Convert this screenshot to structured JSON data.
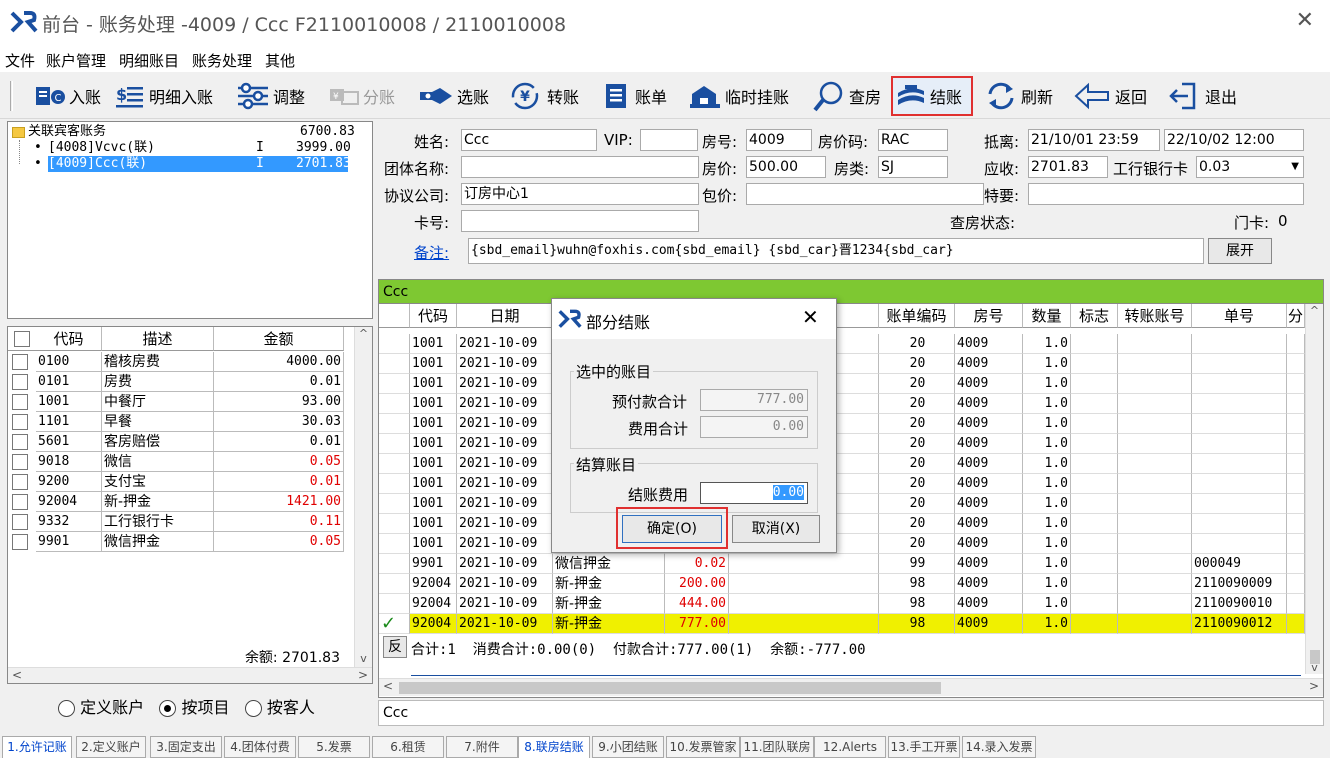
{
  "window": {
    "title": "前台 - 账务处理 -4009 / Ccc F2110010008 / 2110010008",
    "close": "✕"
  },
  "menu": [
    "文件",
    "账户管理",
    "明细账目",
    "账务处理",
    "其他"
  ],
  "toolbar": [
    {
      "label": "入账",
      "icon": "post-icon"
    },
    {
      "label": "明细入账",
      "icon": "detail-post-icon"
    },
    {
      "label": "调整",
      "icon": "adjust-icon"
    },
    {
      "label": "分账",
      "icon": "split-icon",
      "disabled": true
    },
    {
      "label": "选账",
      "icon": "select-icon"
    },
    {
      "label": "转账",
      "icon": "transfer-icon"
    },
    {
      "label": "账单",
      "icon": "bill-icon"
    },
    {
      "label": "临时挂账",
      "icon": "hold-icon"
    },
    {
      "label": "查房",
      "icon": "inspect-icon"
    },
    {
      "label": "结账",
      "icon": "checkout-icon",
      "selected": true
    },
    {
      "label": "刷新",
      "icon": "refresh-icon"
    },
    {
      "label": "返回",
      "icon": "back-icon"
    },
    {
      "label": "退出",
      "icon": "exit-icon"
    }
  ],
  "tree": {
    "root": {
      "label": "关联宾客账务",
      "amount": "6700.83"
    },
    "children": [
      {
        "label": "[4008]Vcvc(联)",
        "flag": "I",
        "amount": "3999.00",
        "selected": false
      },
      {
        "label": "[4009]Ccc(联)",
        "flag": "I",
        "amount": "2701.83",
        "selected": true
      }
    ]
  },
  "items_grid": {
    "headers": [
      "代码",
      "描述",
      "金额"
    ],
    "rows": [
      {
        "code": "0100",
        "desc": "稽核房费",
        "amount": "4000.00",
        "red": false
      },
      {
        "code": "0101",
        "desc": "房费",
        "amount": "0.01",
        "red": false
      },
      {
        "code": "1001",
        "desc": "中餐厅",
        "amount": "93.00",
        "red": false
      },
      {
        "code": "1101",
        "desc": "早餐",
        "amount": "30.03",
        "red": false
      },
      {
        "code": "5601",
        "desc": "客房赔偿",
        "amount": "0.01",
        "red": false
      },
      {
        "code": "9018",
        "desc": "微信",
        "amount": "0.05",
        "red": true
      },
      {
        "code": "9200",
        "desc": "支付宝",
        "amount": "0.01",
        "red": true
      },
      {
        "code": "92004",
        "desc": "新-押金",
        "amount": "1421.00",
        "red": true
      },
      {
        "code": "9332",
        "desc": "工行银行卡",
        "amount": "0.11",
        "red": true
      },
      {
        "code": "9901",
        "desc": "微信押金",
        "amount": "0.05",
        "red": true
      }
    ],
    "balance": "余额: 2701.83"
  },
  "radios": [
    {
      "label": "定义账户",
      "checked": false
    },
    {
      "label": "按项目",
      "checked": true
    },
    {
      "label": "按客人",
      "checked": false
    }
  ],
  "guest": {
    "name_label": "姓名:",
    "name": "Ccc",
    "vip_label": "VIP:",
    "vip": "",
    "room_label": "房号:",
    "room": "4009",
    "rate_code_label": "房价码:",
    "rate_code": "RAC",
    "depart_label": "抵离:",
    "arrive": "21/10/01 23:59",
    "depart": "22/10/02 12:00",
    "group_label": "团体名称:",
    "group": "",
    "price_label": "房价:",
    "price": "500.00",
    "room_type_label": "房类:",
    "room_type": "SJ",
    "due_label": "应收:",
    "due": "2701.83",
    "card_type": "工行银行卡",
    "card_amount": "0.03",
    "company_label": "协议公司:",
    "company": "订房中心1",
    "package_label": "包价:",
    "package": "",
    "special_label": "特要:",
    "special": "",
    "cardno_label": "卡号:",
    "cardno": "",
    "inspect_label": "查房状态:",
    "door_label": "门卡:",
    "door": "0",
    "note_label": "备注:",
    "note": "{sbd_email}wuhn@foxhis.com{sbd_email} {sbd_car}晋1234{sbd_car}",
    "expand_button": "展开"
  },
  "account_bar": "Ccc",
  "main_grid": {
    "headers": [
      "代码",
      "日期",
      "",
      "",
      "账单编码",
      "房号",
      "数量",
      "标志",
      "转账账号",
      "单号",
      "分"
    ],
    "rows": [
      {
        "code": "1001",
        "date": "2021-10-09",
        "desc": "",
        "amount": "",
        "bill": "20",
        "room": "4009",
        "qty": "1.0",
        "no": ""
      },
      {
        "code": "1001",
        "date": "2021-10-09",
        "desc": "",
        "amount": "",
        "bill": "20",
        "room": "4009",
        "qty": "1.0",
        "no": ""
      },
      {
        "code": "1001",
        "date": "2021-10-09",
        "desc": "",
        "amount": "",
        "bill": "20",
        "room": "4009",
        "qty": "1.0",
        "no": ""
      },
      {
        "code": "1001",
        "date": "2021-10-09",
        "desc": "",
        "amount": "",
        "bill": "20",
        "room": "4009",
        "qty": "1.0",
        "no": ""
      },
      {
        "code": "1001",
        "date": "2021-10-09",
        "desc": "",
        "amount": "",
        "bill": "20",
        "room": "4009",
        "qty": "1.0",
        "no": ""
      },
      {
        "code": "1001",
        "date": "2021-10-09",
        "desc": "",
        "amount": "",
        "bill": "20",
        "room": "4009",
        "qty": "1.0",
        "no": ""
      },
      {
        "code": "1001",
        "date": "2021-10-09",
        "desc": "",
        "amount": "",
        "bill": "20",
        "room": "4009",
        "qty": "1.0",
        "no": ""
      },
      {
        "code": "1001",
        "date": "2021-10-09",
        "desc": "",
        "amount": "",
        "bill": "20",
        "room": "4009",
        "qty": "1.0",
        "no": ""
      },
      {
        "code": "1001",
        "date": "2021-10-09",
        "desc": "",
        "amount": "",
        "bill": "20",
        "room": "4009",
        "qty": "1.0",
        "no": ""
      },
      {
        "code": "1001",
        "date": "2021-10-09",
        "desc": "",
        "amount": "",
        "bill": "20",
        "room": "4009",
        "qty": "1.0",
        "no": ""
      },
      {
        "code": "1001",
        "date": "2021-10-09",
        "desc": "",
        "amount": "",
        "bill": "20",
        "room": "4009",
        "qty": "1.0",
        "no": ""
      },
      {
        "code": "9901",
        "date": "2021-10-09",
        "desc": "微信押金",
        "amount": "0.02",
        "bill": "99",
        "room": "4009",
        "qty": "1.0",
        "no": "000049"
      },
      {
        "code": "92004",
        "date": "2021-10-09",
        "desc": "新-押金",
        "amount": "200.00",
        "bill": "98",
        "room": "4009",
        "qty": "1.0",
        "no": "2110090009"
      },
      {
        "code": "92004",
        "date": "2021-10-09",
        "desc": "新-押金",
        "amount": "444.00",
        "bill": "98",
        "room": "4009",
        "qty": "1.0",
        "no": "2110090010"
      },
      {
        "code": "92004",
        "date": "2021-10-09",
        "desc": "新-押金",
        "amount": "777.00",
        "bill": "98",
        "room": "4009",
        "qty": "1.0",
        "no": "2110090012",
        "checked": true
      }
    ],
    "footer_button": "反",
    "footer": "合计:1  消费合计:0.00(0)  付款合计:777.00(1)  余额:-777.00"
  },
  "bottom_label": "Ccc",
  "status_tabs": [
    "1.允许记账",
    "2.定义账户",
    "3.固定支出",
    "4.团体付费",
    "5.发票",
    "6.租赁",
    "7.附件",
    "8.联房结账",
    "9.小团结账",
    "10.发票管家",
    "11.团队联房",
    "12.Alerts",
    "13.手工开票",
    "14.录入发票"
  ],
  "dialog": {
    "title": "部分结账",
    "group1": "选中的账目",
    "prepay_label": "预付款合计",
    "prepay": "777.00",
    "charge_label": "费用合计",
    "charge": "0.00",
    "group2": "结算账目",
    "settle_label": "结账费用",
    "settle": "0.00",
    "ok": "确定(O)",
    "cancel": "取消(X)"
  },
  "colors": {
    "accent_red": "#e03030",
    "highlight_yellow": "#f0f000",
    "green_bar": "#7ec832",
    "selection_blue": "#3399ff"
  }
}
